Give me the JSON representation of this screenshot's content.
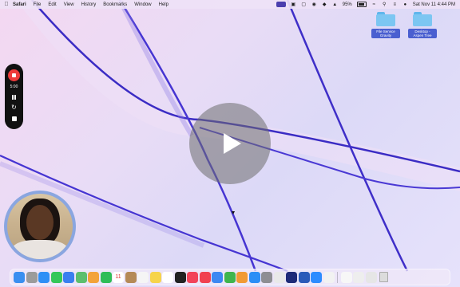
{
  "menubar": {
    "apple_icon": "",
    "app_name": "Safari",
    "items": [
      "File",
      "Edit",
      "View",
      "History",
      "Bookmarks",
      "Window",
      "Help"
    ],
    "battery_text": "95%",
    "clock": "Sat Nov 11  4:44 PM"
  },
  "desktop_folders": [
    {
      "label": "File Service Gravity"
    },
    {
      "label": "Desktop - Aspen Tree"
    }
  ],
  "recorder": {
    "timer": "5:00"
  },
  "dock": {
    "calendar_day": "11",
    "apps": [
      {
        "name": "finder",
        "color": "#3a8ff0"
      },
      {
        "name": "launchpad",
        "color": "#9b9b9b"
      },
      {
        "name": "safari",
        "color": "#2f8ff6"
      },
      {
        "name": "messages",
        "color": "#34c759"
      },
      {
        "name": "mail",
        "color": "#3a7ff0"
      },
      {
        "name": "maps",
        "color": "#5cbf6e"
      },
      {
        "name": "photos",
        "color": "#f3a33a"
      },
      {
        "name": "facetime",
        "color": "#2fbd58"
      },
      {
        "name": "calendar",
        "color": "#ffffff"
      },
      {
        "name": "contacts",
        "color": "#b58a57"
      },
      {
        "name": "reminders",
        "color": "#f5f5f5"
      },
      {
        "name": "notes",
        "color": "#f6d44b"
      },
      {
        "name": "freeform",
        "color": "#ffffff"
      },
      {
        "name": "tv",
        "color": "#222222"
      },
      {
        "name": "music",
        "color": "#f2435a"
      },
      {
        "name": "news",
        "color": "#f14050"
      },
      {
        "name": "keynote",
        "color": "#3d88f2"
      },
      {
        "name": "numbers",
        "color": "#3fb54d"
      },
      {
        "name": "pages",
        "color": "#f19a34"
      },
      {
        "name": "app-store",
        "color": "#2b8ef6"
      },
      {
        "name": "system-settings",
        "color": "#8e8e93"
      },
      {
        "name": "chrome",
        "color": "#e9e9e9"
      },
      {
        "name": "screen-recorder",
        "color": "#1e2a78"
      },
      {
        "name": "word",
        "color": "#2a5ab9"
      },
      {
        "name": "zoom",
        "color": "#2d8cff"
      },
      {
        "name": "preview",
        "color": "#f2f2f2"
      },
      {
        "name": "document-1",
        "color": "#f7f7f7"
      },
      {
        "name": "document-2",
        "color": "#eeeeee"
      },
      {
        "name": "document-3",
        "color": "#e6e6e6"
      },
      {
        "name": "trash",
        "color": "#d6d6d6"
      }
    ]
  }
}
